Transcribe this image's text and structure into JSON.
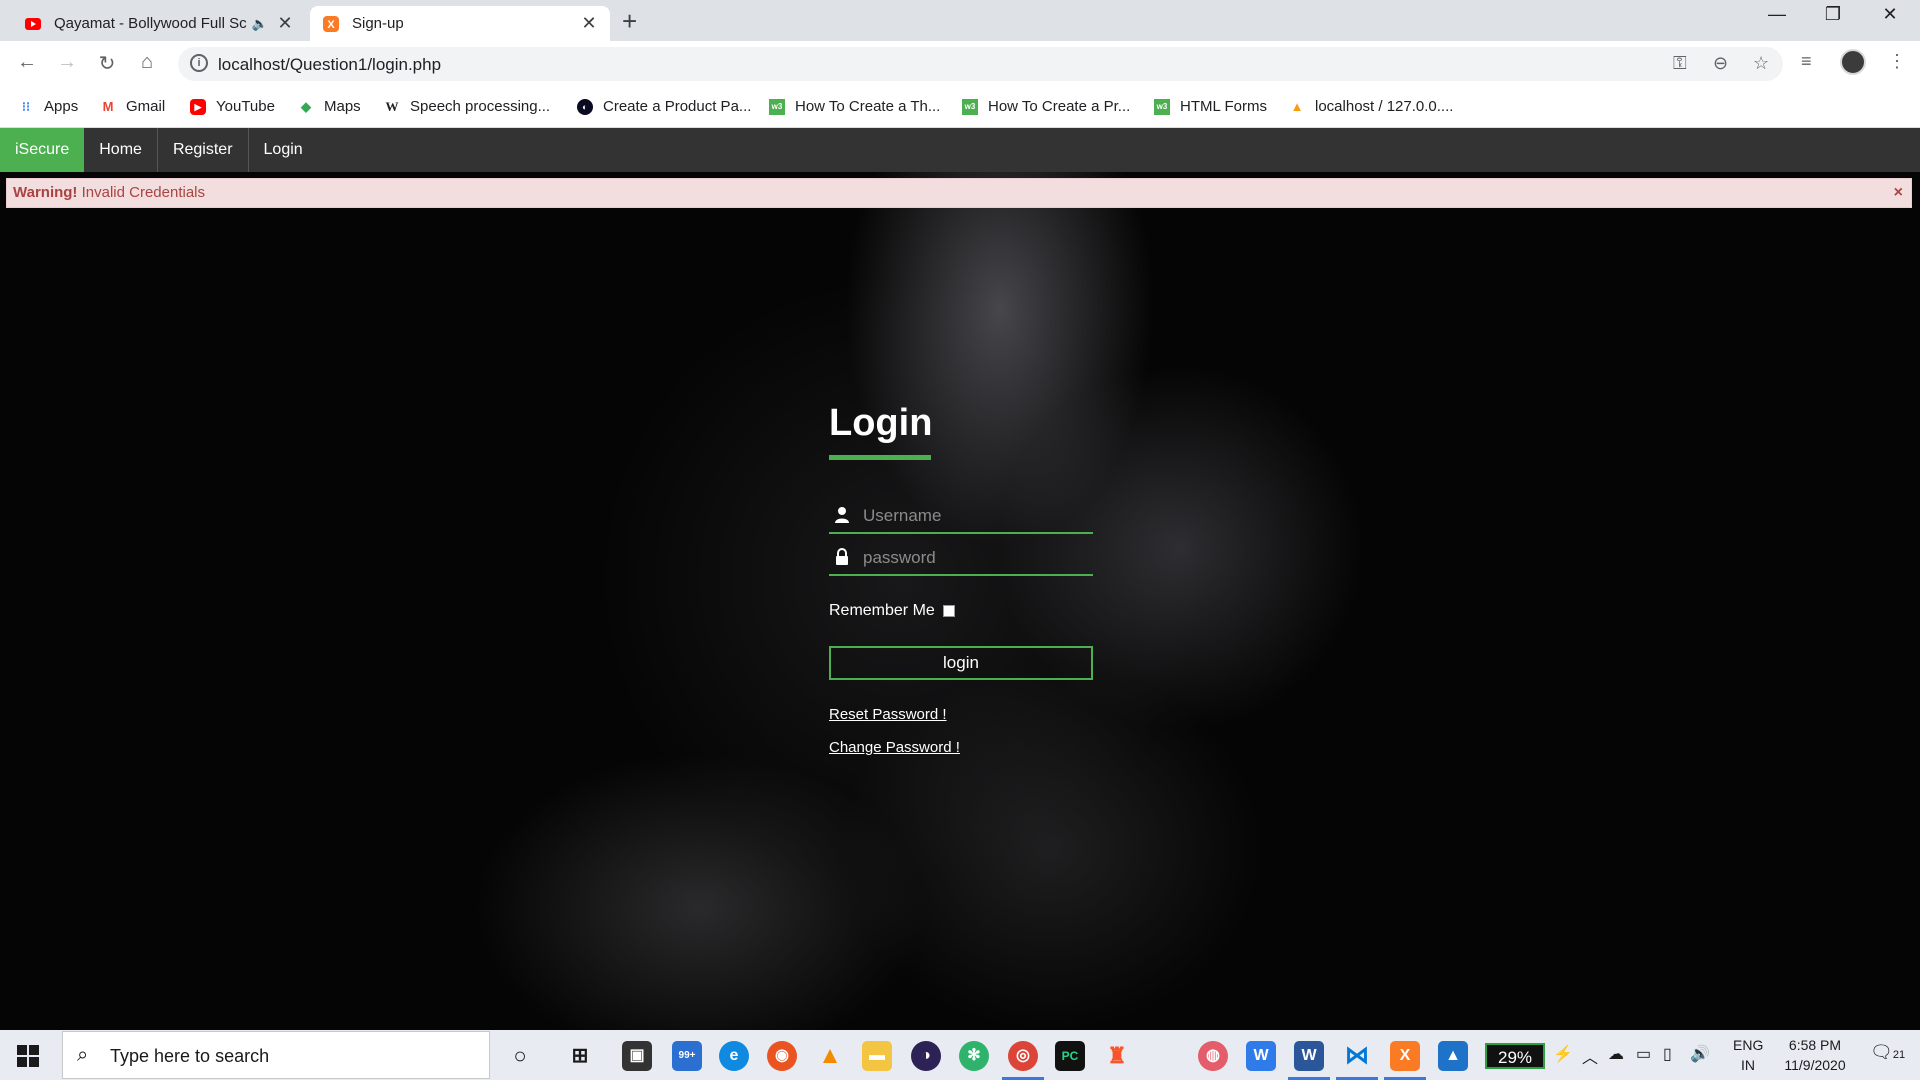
{
  "browser": {
    "tabs": [
      {
        "title": "Qayamat - Bollywood Full Sc",
        "audio_icon": "speaker-muted-icon",
        "favicon": "youtube-icon"
      },
      {
        "title": "Sign-up",
        "favicon": "xampp-icon"
      }
    ],
    "new_tab": "+",
    "address": "localhost/Question1/login.php",
    "window_controls": {
      "minimize": "—",
      "restore": "❐",
      "close": "✕"
    },
    "bookmarks": [
      {
        "label": "Apps",
        "icon": "apps-grid-icon"
      },
      {
        "label": "Gmail",
        "icon": "gmail-icon"
      },
      {
        "label": "YouTube",
        "icon": "youtube-icon"
      },
      {
        "label": "Maps",
        "icon": "maps-icon"
      },
      {
        "label": "Speech processing...",
        "icon": "wikipedia-icon"
      },
      {
        "label": "Create a Product Pa...",
        "icon": "freecodecamp-icon"
      },
      {
        "label": "How To Create a Th...",
        "icon": "w3schools-icon"
      },
      {
        "label": "How To Create a Pr...",
        "icon": "w3schools-icon"
      },
      {
        "label": "HTML Forms",
        "icon": "w3schools-icon"
      },
      {
        "label": "localhost / 127.0.0....",
        "icon": "phpmyadmin-icon"
      }
    ]
  },
  "site": {
    "nav": {
      "brand": "iSecure",
      "links": [
        "Home",
        "Register",
        "Login"
      ]
    },
    "alert": {
      "strong": "Warning!",
      "message": " Invalid Credentials",
      "close": "×"
    },
    "login": {
      "title": "Login",
      "username_placeholder": "Username",
      "password_placeholder": "password",
      "remember_label": "Remember Me",
      "button_label": "login",
      "reset_link": "Reset Password !",
      "change_link": "Change Password !"
    }
  },
  "taskbar": {
    "search_placeholder": "Type here to search",
    "mail_badge": "99+",
    "battery": "29%",
    "language": "ENG",
    "region": "IN",
    "time": "6:58 PM",
    "date": "11/9/2020",
    "notifications": "21"
  }
}
